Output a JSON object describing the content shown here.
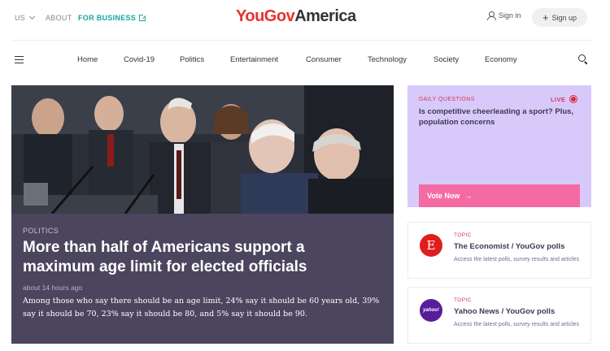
{
  "topbar": {
    "region": "US",
    "about": "ABOUT",
    "business": "FOR BUSINESS",
    "logo_part1": "YouGov",
    "logo_part2": "America",
    "sign_in": "Sign in",
    "sign_up": "Sign up"
  },
  "nav": {
    "items": [
      "Home",
      "Covid-19",
      "Politics",
      "Entertainment",
      "Consumer",
      "Technology",
      "Society",
      "Economy"
    ]
  },
  "hero": {
    "category": "POLITICS",
    "title": "More than half of Americans support a maximum age limit for elected officials",
    "time": "about 14 hours ago",
    "summary": "Among those who say there should be an age limit, 24% say it should be 60 years old, 39% say it should be 70, 23% say it should be 80, and 5% say it should be 90."
  },
  "daily": {
    "label": "DAILY QUESTIONS",
    "live": "LIVE",
    "question": "Is competitive cheerleading a sport? Plus, population concerns",
    "vote": "Vote Now"
  },
  "topics": [
    {
      "label": "TOPIC",
      "title": "The Economist / YouGov polls",
      "desc": "Access the latest polls, survey results and articles",
      "logo": "E"
    },
    {
      "label": "TOPIC",
      "title": "Yahoo News / YouGov polls",
      "desc": "Access the latest polls, survey results and articles",
      "logo": "yahoo!"
    }
  ],
  "colors": {
    "brand_red": "#e6322f",
    "business_teal": "#1aa3a3",
    "hero_panel": "#4c455e",
    "daily_bg": "#d8c9fb",
    "vote_pink": "#f46ba4",
    "accent_pink": "#d6365c"
  }
}
